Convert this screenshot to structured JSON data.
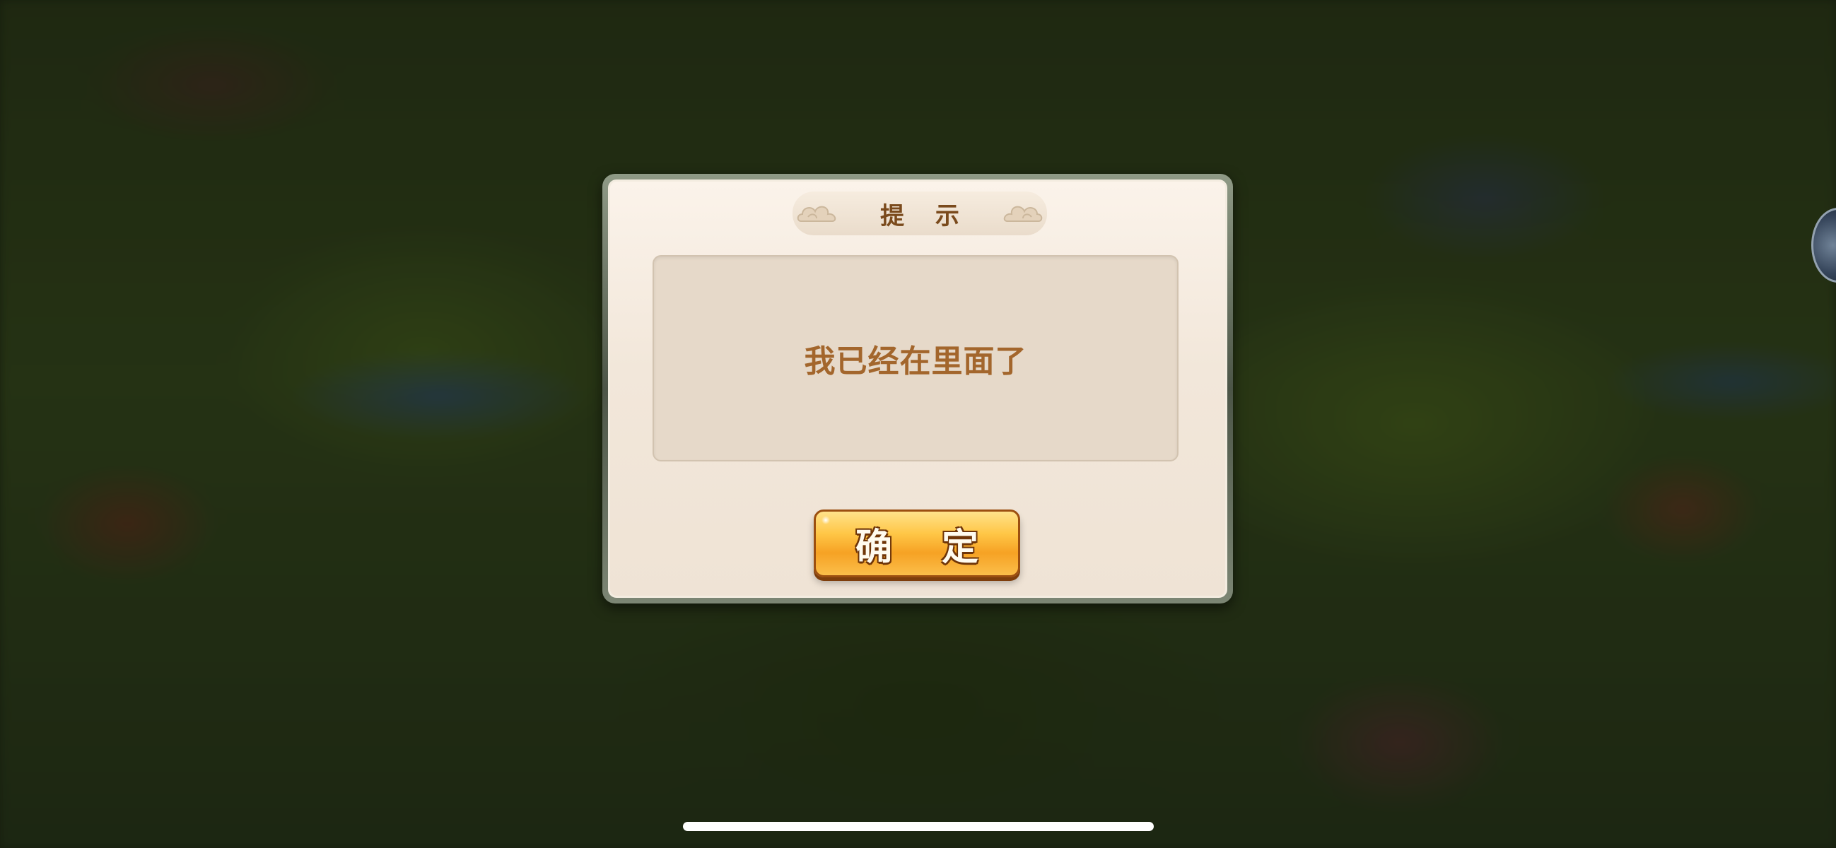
{
  "dialog": {
    "title": "提 示",
    "message": "我已经在里面了",
    "confirm_label": "确 定"
  },
  "icons": {
    "title_ornament_left": "cloud-ornament-icon",
    "title_ornament_right": "cloud-ornament-icon"
  },
  "colors": {
    "title_text": "#7a4a1c",
    "message_text": "#a3662c",
    "button_face": "#ffc646",
    "button_outline": "#9c4f10",
    "dialog_face": "#f2e7da"
  }
}
